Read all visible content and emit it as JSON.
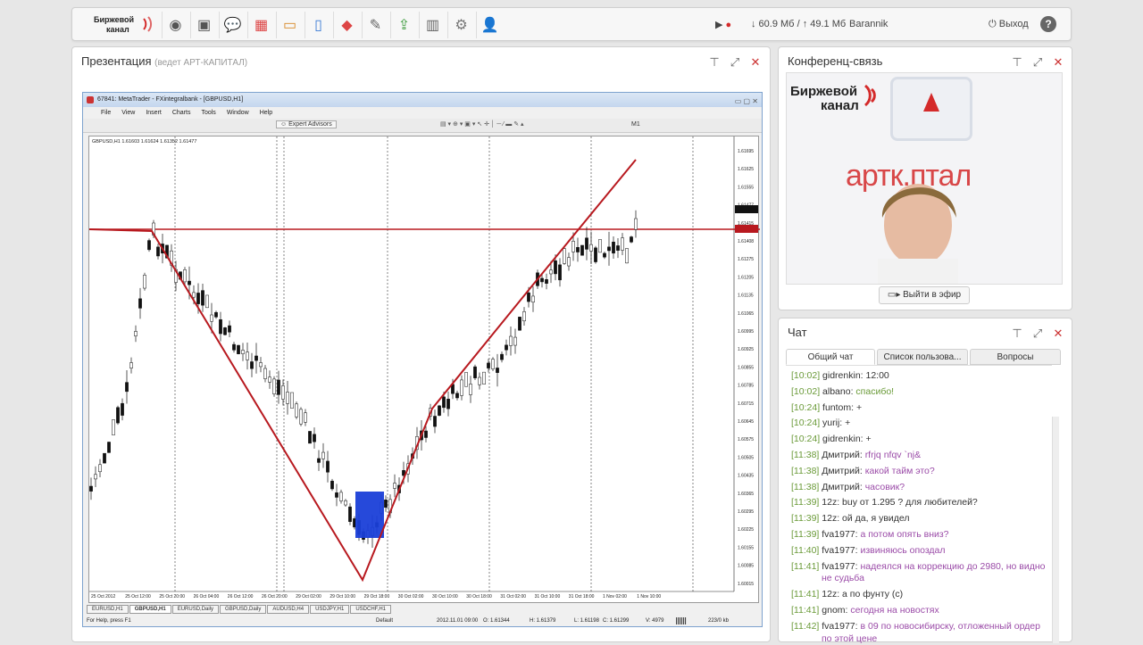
{
  "topbar": {
    "logo_line1": "Биржевой",
    "logo_line2": "канал",
    "icons": [
      "webcam-icon",
      "screen-share-icon",
      "chat-bubble-icon",
      "apps-icon",
      "folder-icon",
      "document-icon",
      "cube-icon",
      "notes-icon",
      "folder-share-icon",
      "layout-icon",
      "gear-icon",
      "add-user-icon"
    ],
    "download": "↓ 60.9 Мб",
    "sep": "/",
    "upload": "↑ 49.1 Мб",
    "username": "Barannik",
    "logout": "Выход",
    "help": "?"
  },
  "presentation": {
    "title": "Презентация",
    "subtitle": "(ведет АРТ-КАПИТАЛ)"
  },
  "metatrader": {
    "window_title": "67841: MetaTrader - FXintegralbank - [GBPUSD,H1]",
    "menu": [
      "File",
      "View",
      "Insert",
      "Charts",
      "Tools",
      "Window",
      "Help"
    ],
    "toolbar_label": "Expert Advisors",
    "timeframe_label": "M1",
    "chart_header": "GBPUSD,H1  1.61603 1.61624 1.61352 1.61477",
    "price_labels": [
      "1.61695",
      "1.61625",
      "1.61555",
      "1.61477",
      "1.61415",
      "1.61408",
      "1.61275",
      "1.61205",
      "1.61135",
      "1.61065",
      "1.60995",
      "1.60925",
      "1.60855",
      "1.60785",
      "1.60715",
      "1.60645",
      "1.60575",
      "1.60505",
      "1.60435",
      "1.60365",
      "1.60295",
      "1.60225",
      "1.60155",
      "1.60085",
      "1.60015"
    ],
    "time_labels": [
      "25 Oct 2012",
      "25 Oct 12:00",
      "25 Oct 20:00",
      "26 Oct 04:00",
      "26 Oct 12:00",
      "26 Oct 20:00",
      "29 Oct 02:00",
      "29 Oct 10:00",
      "29 Oct 18:00",
      "30 Oct 02:00",
      "30 Oct 10:00",
      "30 Oct 18:00",
      "31 Oct 02:00",
      "31 Oct 10:00",
      "31 Oct 18:00",
      "1 Nov 02:00",
      "1 Nov 10:00"
    ],
    "tabs": [
      "EURUSD,H1",
      "GBPUSD,H1",
      "EURUSD,Daily",
      "GBPUSD,Daily",
      "AUDUSD,H4",
      "USDJPY,H1",
      "USDCHF,H1"
    ],
    "active_tab": 1,
    "status_help": "For Help, press F1",
    "status_profile": "Default",
    "status_time": "2012.11.01 09:00",
    "status_o": "O: 1.61344",
    "status_h": "H: 1.61379",
    "status_l": "L: 1.61198",
    "status_c": "C: 1.61299",
    "status_v": "V: 4979",
    "status_kb": "223/0 kb"
  },
  "conference": {
    "title": "Конференц-связь",
    "video_logo_line1": "Биржевой",
    "video_logo_line2": "канал",
    "video_brand": "артк.птал",
    "go_live": "Выйти в эфир"
  },
  "chat": {
    "title": "Чат",
    "tabs": [
      "Общий чат",
      "Список пользова...",
      "Вопросы"
    ],
    "messages": [
      {
        "time": "[10:02]",
        "name": "gidrenkin:",
        "text": "12:00",
        "style": "mb"
      },
      {
        "time": "[10:02]",
        "name": "albano:",
        "text": "спасибо!",
        "style": "mg2"
      },
      {
        "time": "[10:24]",
        "name": "funtom:",
        "text": "+",
        "style": "mb"
      },
      {
        "time": "[10:24]",
        "name": "yurij:",
        "text": "+",
        "style": "mb"
      },
      {
        "time": "[10:24]",
        "name": "gidrenkin:",
        "text": "+",
        "style": "mb"
      },
      {
        "time": "[11:38]",
        "name": "Дмитрий:",
        "text": "rfrjq nfqv `nj&",
        "style": "mg"
      },
      {
        "time": "[11:38]",
        "name": "Дмитрий:",
        "text": "какой тайм это?",
        "style": "mg"
      },
      {
        "time": "[11:38]",
        "name": "Дмитрий:",
        "text": "часовик?",
        "style": "mg"
      },
      {
        "time": "[11:39]",
        "name": "12z:",
        "text": "buy от 1.295 ? для любителей?",
        "style": "mb"
      },
      {
        "time": "[11:39]",
        "name": "12z:",
        "text": "ой да, я увидел",
        "style": "mb"
      },
      {
        "time": "[11:39]",
        "name": "fva1977:",
        "text": "а потом опять вниз?",
        "style": "mg"
      },
      {
        "time": "[11:40]",
        "name": "fva1977:",
        "text": "извиняюсь опоздал",
        "style": "mg"
      },
      {
        "time": "[11:41]",
        "name": "fva1977:",
        "text": "надеялся на коррекцию до 2980, но видно",
        "text2": "не судьба",
        "style": "mg"
      },
      {
        "time": "[11:41]",
        "name": "12z:",
        "text": "а по фунту (c)",
        "style": "mb"
      },
      {
        "time": "[11:41]",
        "name": "gnom:",
        "text": "сегодня на новостях",
        "style": "mg"
      },
      {
        "time": "[11:42]",
        "name": "fva1977:",
        "text": "в 09 по новосибирску, отложенный ордер",
        "text2": "по этой цене",
        "style": "mg"
      }
    ]
  },
  "colors": {
    "accent_red": "#d42a2a",
    "chat_time": "#6a9a38",
    "chat_msg": "#9b4ca8",
    "zigzag": "#b8191f",
    "box_blue": "#1a3fd8"
  }
}
